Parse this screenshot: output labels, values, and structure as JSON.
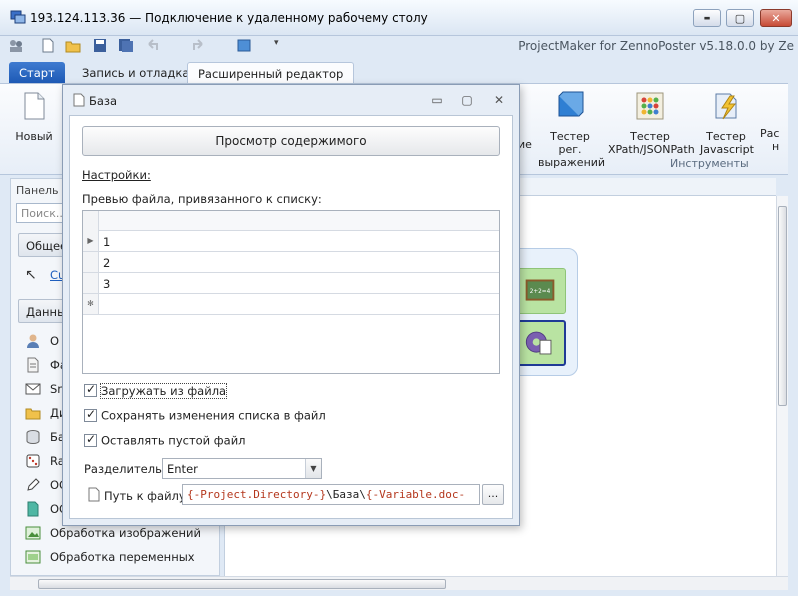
{
  "rdp": {
    "title": "193.124.113.36 — Подключение к удаленному рабочему столу",
    "minimize": "▬",
    "maximize": "▢",
    "close": "✕"
  },
  "app": {
    "title": "ProjectMaker for ZennoPoster v5.18.0.0 by Ze"
  },
  "tabs": [
    {
      "label": "Старт"
    },
    {
      "label": "Запись и отладка"
    },
    {
      "label": "Расширенный редактор"
    }
  ],
  "ribbon": {
    "new_label": "Новый",
    "partial_label": "ие",
    "regex_label_1": "Тестер рег.",
    "regex_label_2": "выражений",
    "xpath_label_1": "Тестер",
    "xpath_label_2": "XPath/JSONPath",
    "js_label_1": "Тестер",
    "js_label_2": "Javascript",
    "cut_label_1": "Рас",
    "cut_label_2": "н",
    "group_tools": "Инструменты"
  },
  "left_panel": {
    "header": "Панель и",
    "search_placeholder": "Поиск...",
    "section_general": "Общее",
    "cursor_item": "Cu",
    "section_data": "Данны",
    "items": [
      {
        "label": "О",
        "icon": "user-icon"
      },
      {
        "label": "Фа",
        "icon": "file-icon"
      },
      {
        "label": "Sn",
        "icon": "email-icon"
      },
      {
        "label": "Ди",
        "icon": "folder-icon"
      },
      {
        "label": "Ба",
        "icon": "database-icon"
      },
      {
        "label": "Ra",
        "icon": "dice-icon"
      },
      {
        "label": "OC",
        "icon": "pen-icon"
      },
      {
        "label": "OC",
        "icon": "file-teal-icon"
      },
      {
        "label": "Обработка изображений",
        "icon": "image-icon"
      },
      {
        "label": "Обработка переменных",
        "icon": "variable-icon"
      }
    ]
  },
  "dialog": {
    "title": "База",
    "view_button": "Просмотр содержимого",
    "settings_link": "Настройки:",
    "preview_label": "Превью файла, привязанного к списку:",
    "grid_rows": [
      "1",
      "2",
      "3"
    ],
    "grid_new_row_marker": "✻",
    "checkbox_load": "Загружать из файла",
    "checkbox_save": "Сохранять изменения списка в файл",
    "checkbox_empty": "Оставлять пустой файл",
    "separator_label": "Разделитель:",
    "separator_value": "Enter",
    "path_label": "Путь к файлу",
    "path_part1": "{-Project.Directory-}",
    "path_part2": "\\База\\",
    "path_part3": "{-Variable.doc-",
    "browse": "..."
  },
  "colors": {
    "accent": "#1c58b4",
    "macro": "#b4371d",
    "variable": "#1f5fbf"
  }
}
